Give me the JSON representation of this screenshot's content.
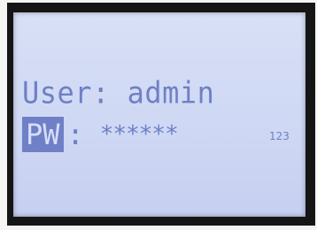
{
  "login": {
    "user_label": "User:",
    "user_value": "admin",
    "password_label": "PW",
    "password_separator": ":",
    "password_value": "******",
    "input_mode": "123"
  },
  "colors": {
    "screen_bg": "#cfd8f4",
    "text": "#6f80c6",
    "highlight_bg": "#6f80c6",
    "bezel": "#151515"
  }
}
